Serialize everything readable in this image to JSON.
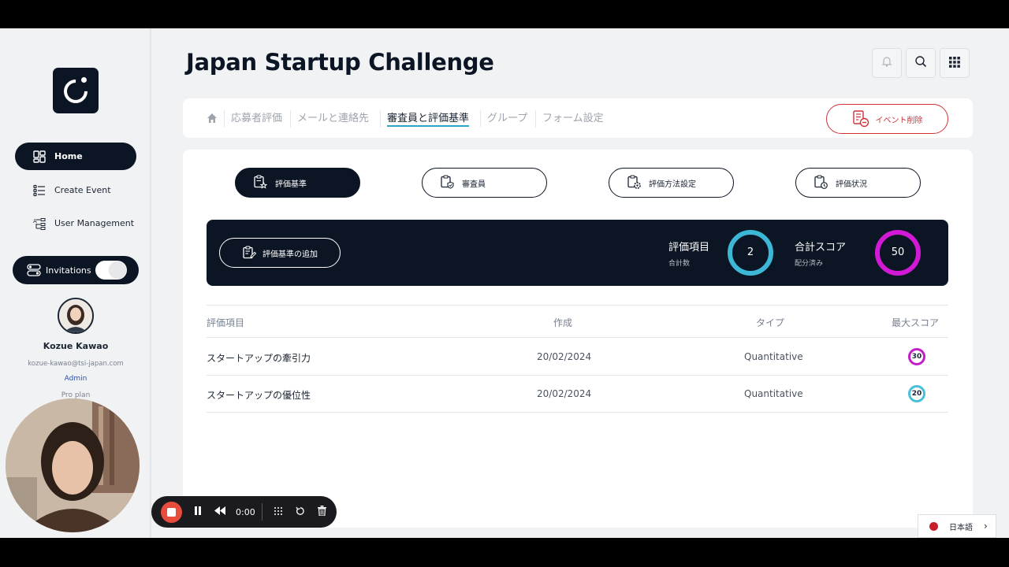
{
  "app": {
    "title": "Japan Startup Challenge"
  },
  "sidebar": {
    "items": [
      {
        "label": "Home",
        "icon": "grid-icon",
        "active": true
      },
      {
        "label": "Create Event",
        "icon": "list-icon",
        "active": false
      },
      {
        "label": "User Management",
        "icon": "hierarchy-icon",
        "active": false
      }
    ],
    "invitations": {
      "label": "Invitations",
      "toggle_on": true
    },
    "user": {
      "name": "Kozue Kawao",
      "email": "kozue-kawao@tsi-japan.com",
      "role": "Admin",
      "plan": "Pro plan"
    }
  },
  "header": {
    "buttons": [
      {
        "icon": "bell-icon"
      },
      {
        "icon": "search-icon"
      },
      {
        "icon": "apps-grid-icon"
      }
    ]
  },
  "tabs": {
    "items": [
      {
        "label": "応募者評価",
        "active": false
      },
      {
        "label": "メールと連絡先",
        "active": false
      },
      {
        "label": "審査員と評価基準",
        "active": true
      },
      {
        "label": "グループ",
        "active": false
      },
      {
        "label": "フォーム設定",
        "active": false
      }
    ],
    "delete_label": "イベント削除"
  },
  "subtabs": [
    {
      "label": "評価基準",
      "active": true
    },
    {
      "label": "審査員",
      "active": false
    },
    {
      "label": "評価方法設定",
      "active": false
    },
    {
      "label": "評価状況",
      "active": false
    }
  ],
  "summary": {
    "add_label": "評価基準の追加",
    "items_label": "評価項目",
    "items_sub": "合計数",
    "items_value": "2",
    "score_label": "合計スコア",
    "score_sub": "配分済み",
    "score_value": "50"
  },
  "table": {
    "columns": [
      "評価項目",
      "作成",
      "タイプ",
      "最大スコア"
    ],
    "rows": [
      {
        "name": "スタートアップの牽引力",
        "created": "20/02/2024",
        "type": "Quantitative",
        "max_score": "30",
        "color": "#c31fc8"
      },
      {
        "name": "スタートアップの優位性",
        "created": "20/02/2024",
        "type": "Quantitative",
        "max_score": "20",
        "color": "#4bbfd8"
      }
    ]
  },
  "recorder": {
    "time": "0:00"
  },
  "language": {
    "label": "日本語"
  },
  "colors": {
    "navy": "#0b1524",
    "accent_cyan": "#3cb8d6",
    "accent_magenta": "#d21ad6",
    "danger": "#d13238"
  }
}
